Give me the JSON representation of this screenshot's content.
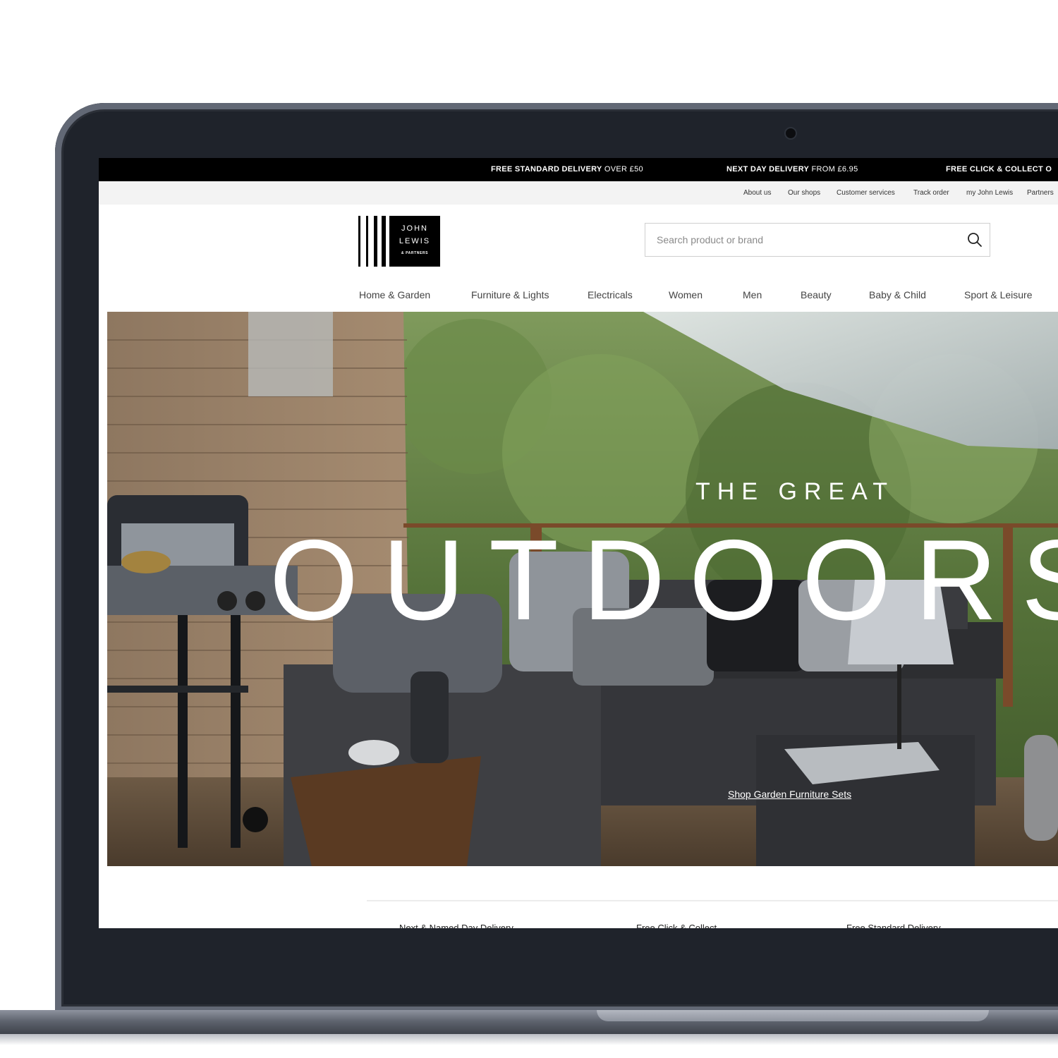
{
  "promo": {
    "delivery_bold": "FREE STANDARD DELIVERY",
    "delivery_rest": " OVER £50",
    "nextday_bold": "NEXT DAY DELIVERY",
    "nextday_rest": " FROM £6.95",
    "click_bold": "FREE CLICK & COLLECT O"
  },
  "util_links": [
    "About us",
    "Our shops",
    "Customer services",
    "Track order",
    "my John Lewis",
    "Partners"
  ],
  "logo": {
    "line1": "JOHN",
    "line2": "LEWIS",
    "line3": "& PARTNERS"
  },
  "search": {
    "placeholder": "Search product or brand"
  },
  "nav": [
    "Home & Garden",
    "Furniture & Lights",
    "Electricals",
    "Women",
    "Men",
    "Beauty",
    "Baby & Child",
    "Sport & Leisure"
  ],
  "hero": {
    "kicker": "THE GREAT",
    "title": "OUTDOORS",
    "link": "Shop Garden Furniture Sets"
  },
  "services": [
    "Next & Named Day Delivery",
    "Free Click & Collect",
    "Free Standard Delivery"
  ],
  "colors": {
    "promo_bar": "#000000",
    "util_bar": "#f3f3f3",
    "laptop_bezel": "#1f232b"
  }
}
